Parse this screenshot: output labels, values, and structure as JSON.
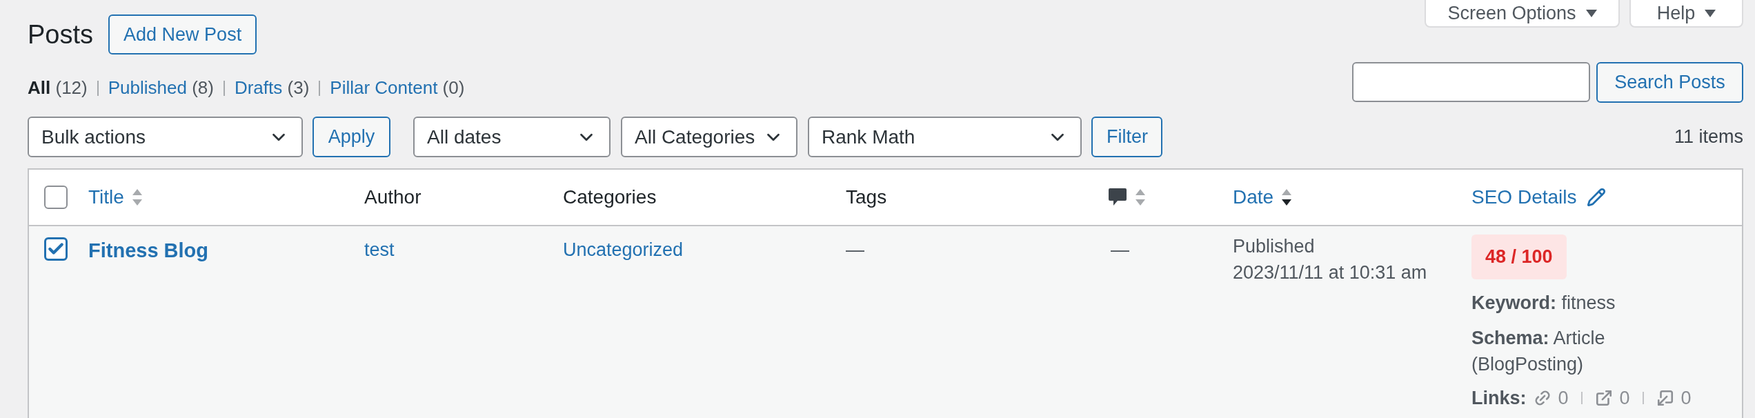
{
  "header": {
    "title": "Posts",
    "add_button": "Add New Post",
    "screen_options": "Screen Options",
    "help": "Help"
  },
  "views": [
    {
      "label": "All",
      "count": "(12)",
      "selected": true
    },
    {
      "label": "Published",
      "count": "(8)",
      "selected": false
    },
    {
      "label": "Drafts",
      "count": "(3)",
      "selected": false
    },
    {
      "label": "Pillar Content",
      "count": "(0)",
      "selected": false
    }
  ],
  "search": {
    "button": "Search Posts"
  },
  "bulk": {
    "select": "Bulk actions",
    "apply": "Apply"
  },
  "filters": {
    "selects": [
      "All dates",
      "All Categories",
      "Rank Math"
    ],
    "button": "Filter"
  },
  "item_count": "11 items",
  "table": {
    "select_all": {
      "checked": false
    },
    "columns": [
      {
        "label": "Title",
        "kind": "sortable"
      },
      {
        "label": "Author",
        "kind": "plain"
      },
      {
        "label": "Categories",
        "kind": "plain"
      },
      {
        "label": "Tags",
        "kind": "plain"
      },
      {
        "kind": "comments"
      },
      {
        "label": "Date",
        "kind": "sorted"
      },
      {
        "label": "SEO Details",
        "kind": "editable"
      }
    ],
    "rows": [
      {
        "checked": true,
        "title": "Fitness Blog",
        "author": "test",
        "category": "Uncategorized",
        "tags": "—",
        "comments": "—",
        "status": "Published",
        "date": "2023/11/11 at 10:31 am",
        "seo": {
          "score": "48 / 100",
          "keyword_label": "Keyword:",
          "keyword": "fitness",
          "schema_label": "Schema:",
          "schema": "Article (BlogPosting)",
          "links_label": "Links:",
          "links": [
            {
              "kind": "internal",
              "count": "0"
            },
            {
              "kind": "external",
              "count": "0"
            },
            {
              "kind": "incoming",
              "count": "0"
            }
          ]
        }
      }
    ]
  }
}
